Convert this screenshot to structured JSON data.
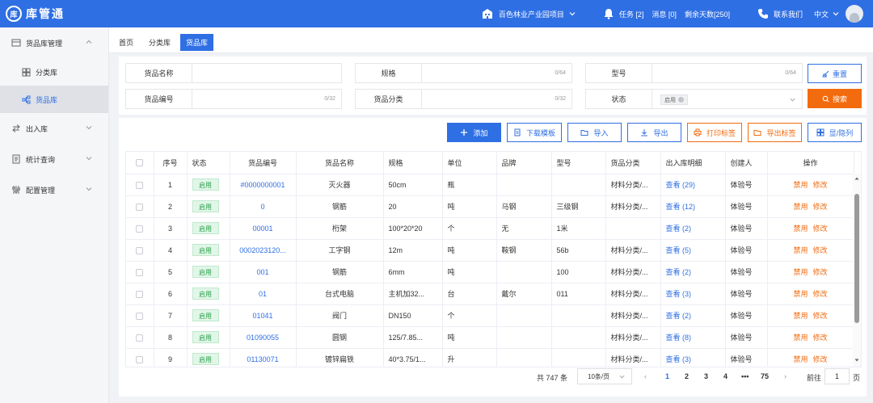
{
  "app": {
    "logo_mark": "库",
    "name": "库管通"
  },
  "header": {
    "project": "百色林业产业园项目",
    "tasks": "任务 [2]",
    "messages": "消息 [0]",
    "days_left": "剩余天数[250]",
    "contact": "联系我们",
    "language": "中文"
  },
  "sidebar": {
    "group1": "货品库管理",
    "sub1": "分类库",
    "sub2": "货品库",
    "group2": "出入库",
    "group3": "统计查询",
    "group4": "配置管理"
  },
  "tabs": [
    "首页",
    "分类库",
    "货品库"
  ],
  "search": {
    "name_label": "货品名称",
    "spec_label": "规格",
    "spec_count": "0/64",
    "model_label": "型号",
    "model_count": "0/64",
    "code_label": "货品编号",
    "code_count": "0/32",
    "category_label": "货品分类",
    "category_count": "0/32",
    "status_label": "状态",
    "status_value": "启用",
    "reset_label": "重置",
    "search_label": "搜索"
  },
  "toolbar": {
    "add": "添加",
    "download": "下载模板",
    "import": "导入",
    "export": "导出",
    "print": "打印标签",
    "export_label": "导出标签",
    "columns": "显/隐列"
  },
  "table": {
    "headers": [
      "序号",
      "状态",
      "货品编号",
      "货品名称",
      "规格",
      "单位",
      "品牌",
      "型号",
      "货品分类",
      "出入库明细",
      "创建人",
      "操作"
    ],
    "rows": [
      {
        "no": "1",
        "status": "启用",
        "code": "#0000000001",
        "name": "灭火器",
        "spec": "50cm",
        "unit": "瓶",
        "brand": "",
        "model": "",
        "category": "材料分类/...",
        "detail": "查看 (29)",
        "creator": "体验号",
        "op1": "禁用",
        "op2": "修改"
      },
      {
        "no": "2",
        "status": "启用",
        "code": "0",
        "name": "钢筋",
        "spec": "20",
        "unit": "吨",
        "brand": "马钢",
        "model": "三级钢",
        "category": "材料分类/...",
        "detail": "查看 (12)",
        "creator": "体验号",
        "op1": "禁用",
        "op2": "修改"
      },
      {
        "no": "3",
        "status": "启用",
        "code": "00001",
        "name": "桁架",
        "spec": "100*20*20",
        "unit": "个",
        "brand": "无",
        "model": "1米",
        "category": "",
        "detail": "查看 (2)",
        "creator": "体验号",
        "op1": "禁用",
        "op2": "修改"
      },
      {
        "no": "4",
        "status": "启用",
        "code": "0002023120...",
        "name": "工字钢",
        "spec": "12m",
        "unit": "吨",
        "brand": "鞍钢",
        "model": "56b",
        "category": "材料分类/...",
        "detail": "查看 (5)",
        "creator": "体验号",
        "op1": "禁用",
        "op2": "修改"
      },
      {
        "no": "5",
        "status": "启用",
        "code": "001",
        "name": "钢筋",
        "spec": "6mm",
        "unit": "吨",
        "brand": "",
        "model": "100",
        "category": "材料分类/...",
        "detail": "查看 (2)",
        "creator": "体验号",
        "op1": "禁用",
        "op2": "修改"
      },
      {
        "no": "6",
        "status": "启用",
        "code": "01",
        "name": "台式电脑",
        "spec": "主机加32...",
        "unit": "台",
        "brand": "戴尔",
        "model": "011",
        "category": "材料分类/...",
        "detail": "查看 (3)",
        "creator": "体验号",
        "op1": "禁用",
        "op2": "修改"
      },
      {
        "no": "7",
        "status": "启用",
        "code": "01041",
        "name": "阀门",
        "spec": "DN150",
        "unit": "个",
        "brand": "",
        "model": "",
        "category": "材料分类/...",
        "detail": "查看 (2)",
        "creator": "体验号",
        "op1": "禁用",
        "op2": "修改"
      },
      {
        "no": "8",
        "status": "启用",
        "code": "01090055",
        "name": "圆钢",
        "spec": "125/7.85...",
        "unit": "吨",
        "brand": "",
        "model": "",
        "category": "材料分类/...",
        "detail": "查看 (8)",
        "creator": "体验号",
        "op1": "禁用",
        "op2": "修改"
      },
      {
        "no": "9",
        "status": "启用",
        "code": "01130071",
        "name": "镀锌扁铁",
        "spec": "40*3.75/1...",
        "unit": "升",
        "brand": "",
        "model": "",
        "category": "材料分类/...",
        "detail": "查看 (3)",
        "creator": "体验号",
        "op1": "禁用",
        "op2": "修改"
      }
    ]
  },
  "pager": {
    "total": "共 747 条",
    "page_size": "10条/页",
    "pages": [
      "1",
      "2",
      "3",
      "4",
      "•••",
      "75"
    ],
    "goto_label": "前往",
    "goto_value": "1",
    "goto_unit": "页"
  },
  "colors": {
    "primary": "#2f6fe4",
    "accent": "#f26b0f",
    "success": "#2aa24a"
  }
}
